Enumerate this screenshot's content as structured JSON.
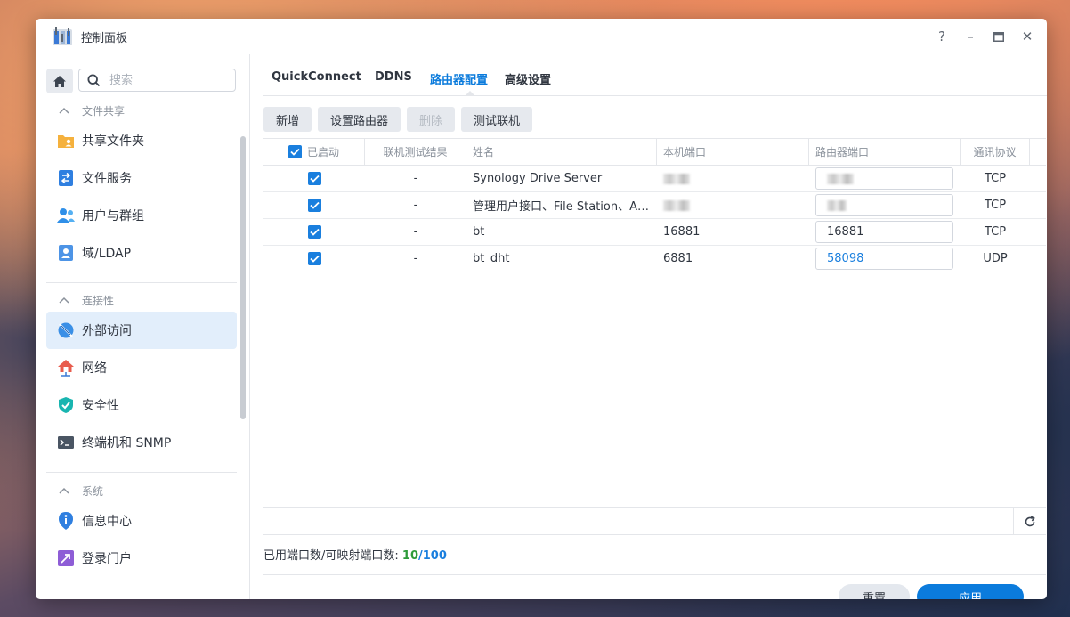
{
  "window": {
    "title": "控制面板",
    "help": "?",
    "minimize": "–",
    "close": "✕"
  },
  "search": {
    "placeholder": "搜索"
  },
  "sidebar": {
    "sections": [
      {
        "label": "文件共享",
        "items": [
          {
            "label": "共享文件夹",
            "icon": "shared-folder-icon"
          },
          {
            "label": "文件服务",
            "icon": "file-services-icon"
          },
          {
            "label": "用户与群组",
            "icon": "users-groups-icon"
          },
          {
            "label": "域/LDAP",
            "icon": "domain-ldap-icon"
          }
        ]
      },
      {
        "label": "连接性",
        "items": [
          {
            "label": "外部访问",
            "icon": "external-access-icon",
            "active": true
          },
          {
            "label": "网络",
            "icon": "network-icon"
          },
          {
            "label": "安全性",
            "icon": "security-shield-icon"
          },
          {
            "label": "终端机和 SNMP",
            "icon": "terminal-icon"
          }
        ]
      },
      {
        "label": "系统",
        "items": [
          {
            "label": "信息中心",
            "icon": "info-center-icon"
          },
          {
            "label": "登录门户",
            "icon": "login-portal-icon"
          }
        ]
      }
    ]
  },
  "tabs": [
    {
      "label": "QuickConnect"
    },
    {
      "label": "DDNS"
    },
    {
      "label": "路由器配置",
      "active": true
    },
    {
      "label": "高级设置"
    }
  ],
  "toolbar": {
    "add": "新增",
    "setup_router": "设置路由器",
    "delete": "删除",
    "test": "测试联机"
  },
  "table": {
    "headers": {
      "enabled": "已启动",
      "test_result": "联机测试结果",
      "name": "姓名",
      "local_port": "本机端口",
      "router_port": "路由器端口",
      "protocol": "通讯协议"
    },
    "rows": [
      {
        "test_result": "-",
        "name": "Synology Drive Server",
        "local_port": "",
        "router_port": "",
        "protocol": "TCP"
      },
      {
        "test_result": "-",
        "name": "管理用户接口、File Station、Audio Station",
        "local_port": "",
        "router_port": "",
        "protocol": "TCP"
      },
      {
        "test_result": "-",
        "name": "bt",
        "local_port": "16881",
        "router_port": "16881",
        "protocol": "TCP"
      },
      {
        "test_result": "-",
        "name": "bt_dht",
        "local_port": "6881",
        "router_port": "58098",
        "protocol": "UDP"
      }
    ]
  },
  "footer": {
    "port_label": "已用端口数/可映射端口数:",
    "used": "10",
    "slash": "/",
    "total": "100",
    "reset": "重置",
    "apply": "应用"
  },
  "colors": {
    "accent": "#0b7bdc",
    "used": "#2e9b3a",
    "active_bg": "#e2eefb"
  }
}
